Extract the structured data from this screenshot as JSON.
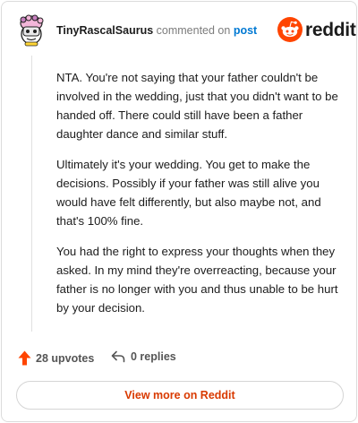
{
  "header": {
    "username": "TinyRascalSaurus",
    "action_text": "commented on",
    "post_link": "post",
    "brand": "reddit"
  },
  "comment": {
    "paragraphs": [
      "NTA. You're not saying that your father couldn't be involved in the wedding, just that you didn't want to be handed off. There could still have been a father daughter dance and similar stuff.",
      "Ultimately it's your wedding. You get to make the decisions. Possibly if your father was still alive you would have felt differently, but also maybe not, and that's 100% fine.",
      "You had the right to express your thoughts when they asked. In my mind they're overreacting, because your father is no longer with you and thus unable to be hurt by your decision."
    ]
  },
  "actions": {
    "upvotes": "28 upvotes",
    "replies": "0 replies"
  },
  "footer": {
    "view_more": "View more on Reddit"
  },
  "icons": {
    "avatar": "snoo-avatar-icon",
    "brand": "reddit-logo-icon",
    "upvote": "upvote-arrow-icon",
    "reply": "reply-arrow-icon"
  },
  "colors": {
    "brand_orange": "#ff4500",
    "upvote_orange": "#ff4500",
    "link_blue": "#0079d3",
    "view_more_text": "#d93a00"
  }
}
